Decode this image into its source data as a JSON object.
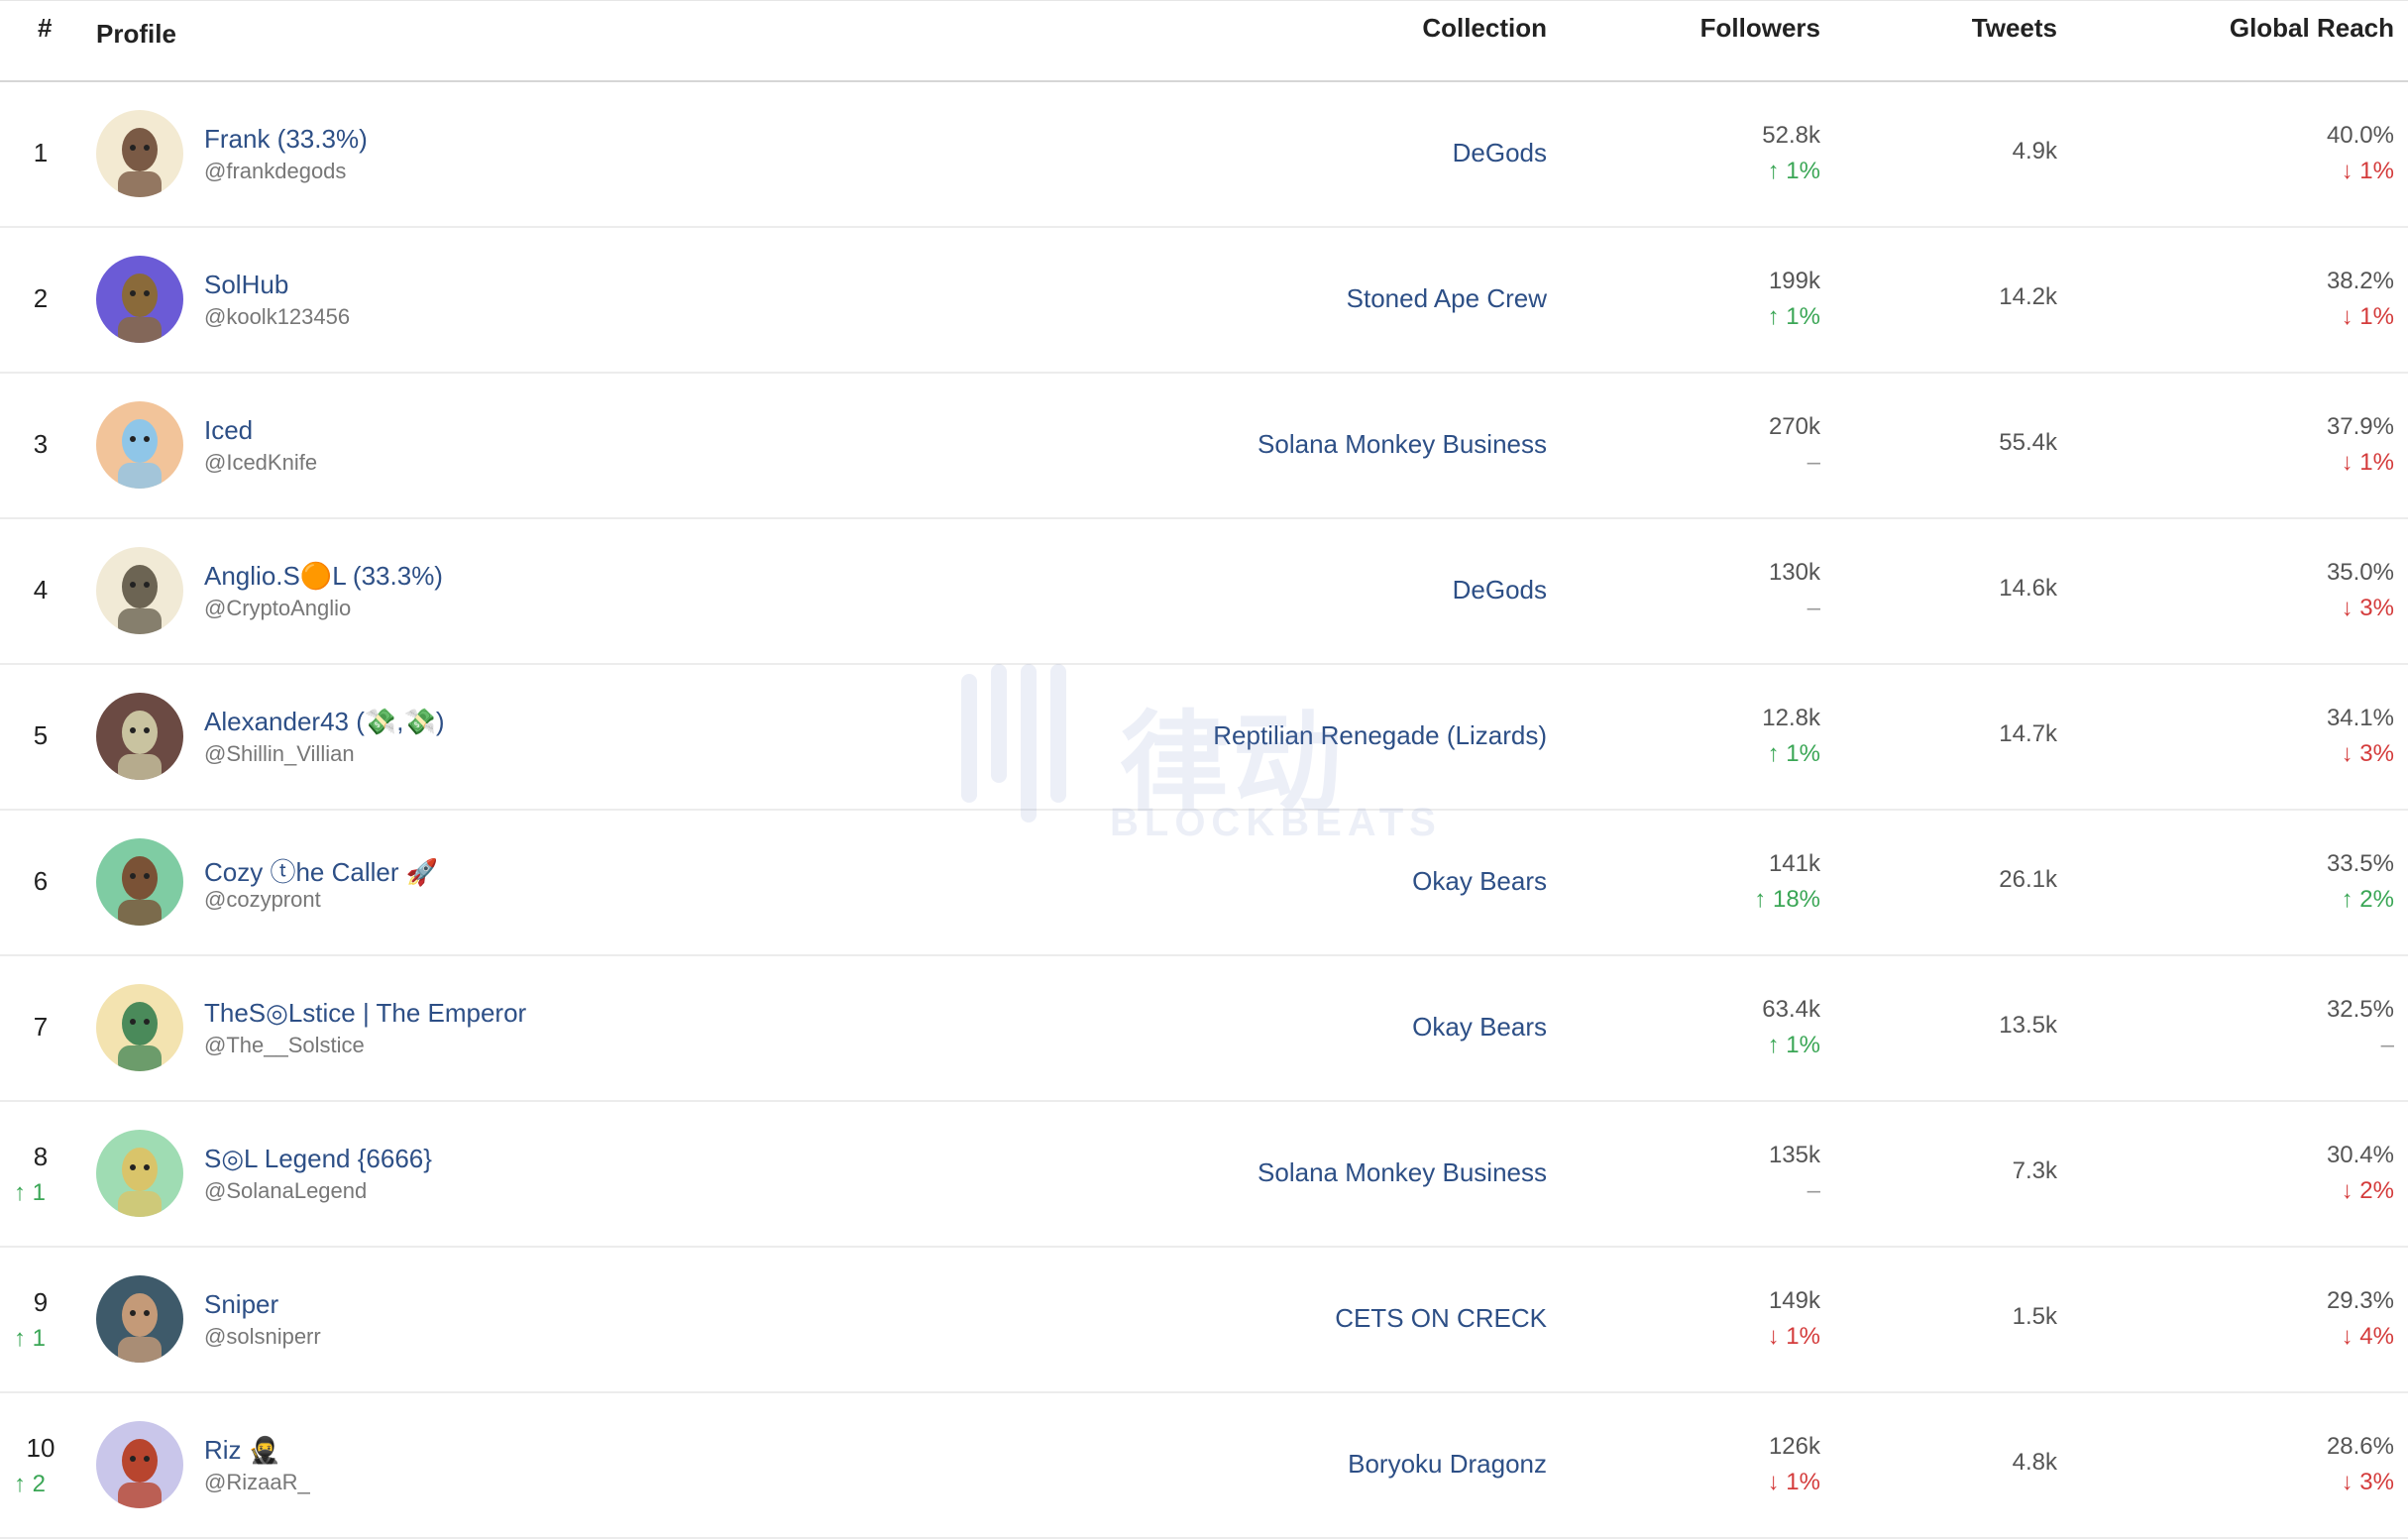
{
  "header": {
    "rank": "#",
    "profile": "Profile",
    "collection": "Collection",
    "followers": "Followers",
    "tweets": "Tweets",
    "reach": "Global Reach"
  },
  "watermark": {
    "text": "律动",
    "sub": "BLOCKBEATS"
  },
  "rows": [
    {
      "rank": "1",
      "rank_change": "",
      "name": "Frank (33.3%)",
      "handle": "@frankdegods",
      "collection": "DeGods",
      "followers": "52.8k",
      "followers_delta": "↑ 1%",
      "followers_dir": "up",
      "tweets": "4.9k",
      "reach": "40.0%",
      "reach_delta": "↓ 1%",
      "reach_dir": "down",
      "avatar_bg": "#f3ead2",
      "avatar_fg": "#7a5a45"
    },
    {
      "rank": "2",
      "rank_change": "",
      "name": "SolHub",
      "handle": "@koolk123456",
      "collection": "Stoned Ape Crew",
      "followers": "199k",
      "followers_delta": "↑ 1%",
      "followers_dir": "up",
      "tweets": "14.2k",
      "reach": "38.2%",
      "reach_delta": "↓ 1%",
      "reach_dir": "down",
      "avatar_bg": "#6b5bd6",
      "avatar_fg": "#8a6a3a"
    },
    {
      "rank": "3",
      "rank_change": "",
      "name": "Iced",
      "handle": "@IcedKnife",
      "collection": "Solana Monkey Business",
      "followers": "270k",
      "followers_delta": "–",
      "followers_dir": "flat",
      "tweets": "55.4k",
      "reach": "37.9%",
      "reach_delta": "↓ 1%",
      "reach_dir": "down",
      "avatar_bg": "#f2c49a",
      "avatar_fg": "#8fc6e8"
    },
    {
      "rank": "4",
      "rank_change": "",
      "name": "Anglio.S🟠L (33.3%)",
      "handle": "@CryptoAnglio",
      "collection": "DeGods",
      "followers": "130k",
      "followers_delta": "–",
      "followers_dir": "flat",
      "tweets": "14.6k",
      "reach": "35.0%",
      "reach_delta": "↓ 3%",
      "reach_dir": "down",
      "avatar_bg": "#f1ead6",
      "avatar_fg": "#6c6453"
    },
    {
      "rank": "5",
      "rank_change": "",
      "name": "Alexander43 (💸,💸)",
      "handle": "@Shillin_Villian",
      "collection": "Reptilian Renegade (Lizards)",
      "followers": "12.8k",
      "followers_delta": "↑ 1%",
      "followers_dir": "up",
      "tweets": "14.7k",
      "reach": "34.1%",
      "reach_delta": "↓ 3%",
      "reach_dir": "down",
      "avatar_bg": "#6b4a43",
      "avatar_fg": "#c9c3a0"
    },
    {
      "rank": "6",
      "rank_change": "",
      "name": "Cozy ⓣhe Caller 🚀",
      "handle": "@cozypront",
      "collection": "Okay Bears",
      "followers": "141k",
      "followers_delta": "↑ 18%",
      "followers_dir": "up",
      "tweets": "26.1k",
      "reach": "33.5%",
      "reach_delta": "↑ 2%",
      "reach_dir": "up",
      "avatar_bg": "#7fcca3",
      "avatar_fg": "#7a5236"
    },
    {
      "rank": "7",
      "rank_change": "",
      "name": "TheS◎Lstice | The Emperor",
      "handle": "@The__Solstice",
      "collection": "Okay Bears",
      "followers": "63.4k",
      "followers_delta": "↑ 1%",
      "followers_dir": "up",
      "tweets": "13.5k",
      "reach": "32.5%",
      "reach_delta": "–",
      "reach_dir": "flat",
      "avatar_bg": "#f3e3b0",
      "avatar_fg": "#4a8a5a"
    },
    {
      "rank": "8",
      "rank_change": "↑ 1",
      "name": "S◎L Legend {6666}",
      "handle": "@SolanaLegend",
      "collection": "Solana Monkey Business",
      "followers": "135k",
      "followers_delta": "–",
      "followers_dir": "flat",
      "tweets": "7.3k",
      "reach": "30.4%",
      "reach_delta": "↓ 2%",
      "reach_dir": "down",
      "avatar_bg": "#9fdcb3",
      "avatar_fg": "#d9c46a"
    },
    {
      "rank": "9",
      "rank_change": "↑ 1",
      "name": "Sniper",
      "handle": "@solsniperr",
      "collection": "CETS ON CRECK",
      "followers": "149k",
      "followers_delta": "↓ 1%",
      "followers_dir": "down",
      "tweets": "1.5k",
      "reach": "29.3%",
      "reach_delta": "↓ 4%",
      "reach_dir": "down",
      "avatar_bg": "#3e5a6a",
      "avatar_fg": "#c49a78"
    },
    {
      "rank": "10",
      "rank_change": "↑ 2",
      "name": "Riz 🥷",
      "handle": "@RizaaR_",
      "collection": "Boryoku Dragonz",
      "followers": "126k",
      "followers_delta": "↓ 1%",
      "followers_dir": "down",
      "tweets": "4.8k",
      "reach": "28.6%",
      "reach_delta": "↓ 3%",
      "reach_dir": "down",
      "avatar_bg": "#c9c6ea",
      "avatar_fg": "#b8452e"
    }
  ]
}
